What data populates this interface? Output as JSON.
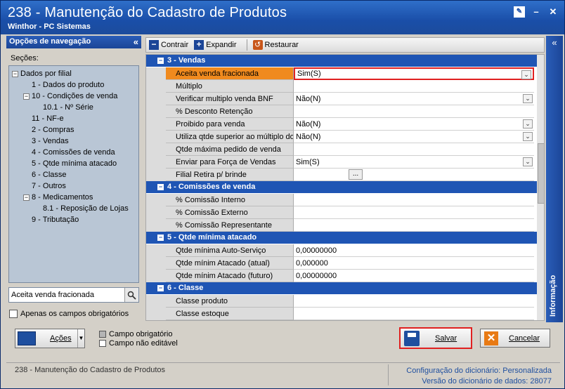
{
  "window": {
    "title": "238 - Manutenção do Cadastro de Produtos",
    "subtitle": "Winthor - PC Sistemas"
  },
  "nav": {
    "header": "Opções de navegação",
    "sections_label": "Seções:",
    "tree": [
      {
        "label": "Dados por filial",
        "level": 0,
        "expander": "−"
      },
      {
        "label": "1 - Dados do produto",
        "level": 1,
        "expander": ""
      },
      {
        "label": "10 - Condições de venda",
        "level": 1,
        "expander": "−"
      },
      {
        "label": "10.1 - Nº Série",
        "level": 2,
        "expander": ""
      },
      {
        "label": "11 - NF-e",
        "level": 1,
        "expander": ""
      },
      {
        "label": "2 - Compras",
        "level": 1,
        "expander": ""
      },
      {
        "label": "3 - Vendas",
        "level": 1,
        "expander": ""
      },
      {
        "label": "4 - Comissões de venda",
        "level": 1,
        "expander": ""
      },
      {
        "label": "5 - Qtde mínima atacado",
        "level": 1,
        "expander": ""
      },
      {
        "label": "6 - Classe",
        "level": 1,
        "expander": ""
      },
      {
        "label": "7 - Outros",
        "level": 1,
        "expander": ""
      },
      {
        "label": "8 - Medicamentos",
        "level": 1,
        "expander": "−"
      },
      {
        "label": "8.1 -  Reposição de Lojas",
        "level": 2,
        "expander": ""
      },
      {
        "label": "9 - Tributação",
        "level": 1,
        "expander": ""
      }
    ],
    "search_value": "Aceita venda fracionada",
    "only_required_label": "Apenas os campos obrigatórios"
  },
  "toolbar": {
    "collapse": "Contrair",
    "expand": "Expandir",
    "restore": "Restaurar"
  },
  "grid": {
    "groups": [
      {
        "title": "3 - Vendas",
        "rows": [
          {
            "label": "Aceita venda fracionada",
            "value": "Sim(S)",
            "dropdown": true,
            "selected": true
          },
          {
            "label": "Múltiplo",
            "value": ""
          },
          {
            "label": "Verificar multiplo venda BNF",
            "value": "Não(N)",
            "dropdown": true
          },
          {
            "label": "% Desconto Retenção",
            "value": ""
          },
          {
            "label": "Proibido para venda",
            "value": "Não(N)",
            "dropdown": true
          },
          {
            "label": "Utiliza qtde superior ao múltiplo do",
            "value": "Não(N)",
            "dropdown": true
          },
          {
            "label": "Qtde máxima pedido de venda",
            "value": ""
          },
          {
            "label": "Enviar para Força de Vendas",
            "value": "Sim(S)",
            "dropdown": true
          },
          {
            "label": "Filial Retira p/ brinde",
            "value": "",
            "ellipsis": "..."
          }
        ]
      },
      {
        "title": "4 - Comissões de venda",
        "rows": [
          {
            "label": "% Comissão Interno",
            "value": ""
          },
          {
            "label": "% Comissão Externo",
            "value": ""
          },
          {
            "label": "% Comissão Representante",
            "value": ""
          }
        ]
      },
      {
        "title": "5 - Qtde mínima atacado",
        "rows": [
          {
            "label": "Qtde mínima Auto-Serviço",
            "value": "0,00000000"
          },
          {
            "label": "Qtde mínim Atacado (atual)",
            "value": "0,000000"
          },
          {
            "label": "Qtde mínim Atacado (futuro)",
            "value": "0,00000000"
          }
        ]
      },
      {
        "title": "6 - Classe",
        "rows": [
          {
            "label": "Classe produto",
            "value": ""
          },
          {
            "label": "Classe estoque",
            "value": ""
          }
        ]
      }
    ]
  },
  "info_panel": {
    "label": "Informação"
  },
  "bottom": {
    "actions_label": "Ações",
    "legend_required": "Campo obrigatório",
    "legend_not_editable": "Campo não editável",
    "save_label": "Salvar",
    "cancel_label": "Cancelar"
  },
  "status": {
    "left": "238 - Manutenção do Cadastro de Produtos",
    "config_key": "Configuração do dicionário:",
    "config_value": "Personalizada",
    "version_key": "Versão do dicionário de dados:",
    "version_value": "28077"
  }
}
